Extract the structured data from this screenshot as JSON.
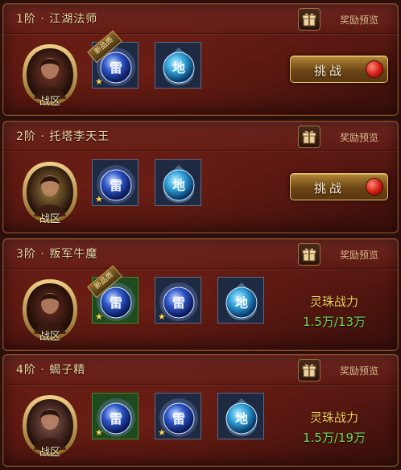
{
  "cards": [
    {
      "title": "1阶 · 江湖法师",
      "reward_label": "奖励预览",
      "zone_label": "战区",
      "orbs": [
        {
          "char": "雷",
          "style": "blue",
          "star": true,
          "new_tag": "新品质"
        },
        {
          "char": "地",
          "style": "water",
          "star": false
        }
      ],
      "action": {
        "type": "button",
        "label": "挑战"
      }
    },
    {
      "title": "2阶 · 托塔李天王",
      "reward_label": "奖励预览",
      "zone_label": "战区",
      "orbs": [
        {
          "char": "雷",
          "style": "blue",
          "star": true
        },
        {
          "char": "地",
          "style": "water",
          "star": false
        }
      ],
      "action": {
        "type": "button",
        "label": "挑战"
      }
    },
    {
      "title": "3阶 · 叛军牛魔",
      "reward_label": "奖励预览",
      "zone_label": "战区",
      "orbs": [
        {
          "char": "雷",
          "style": "blue",
          "star": true,
          "green": true,
          "new_tag": "新品质"
        },
        {
          "char": "雷",
          "style": "blue",
          "star": true
        },
        {
          "char": "地",
          "style": "water",
          "star": false
        }
      ],
      "action": {
        "type": "power",
        "label": "灵珠战力",
        "value": "1.5万/13万"
      }
    },
    {
      "title": "4阶 · 蝎子精",
      "reward_label": "奖励预览",
      "zone_label": "战区",
      "orbs": [
        {
          "char": "雷",
          "style": "blue",
          "star": true,
          "green": true
        },
        {
          "char": "雷",
          "style": "blue",
          "star": true
        },
        {
          "char": "地",
          "style": "water",
          "star": false
        }
      ],
      "action": {
        "type": "power",
        "label": "灵珠战力",
        "value": "1.5万/19万"
      }
    }
  ],
  "colors": {
    "title": "#f2d9a8",
    "power_label": "#ffcf5a",
    "power_value": "#6ed65a"
  },
  "icons": {
    "gift": "gift-box-icon",
    "action_dot": "red-gem-icon",
    "star": "star-icon"
  }
}
